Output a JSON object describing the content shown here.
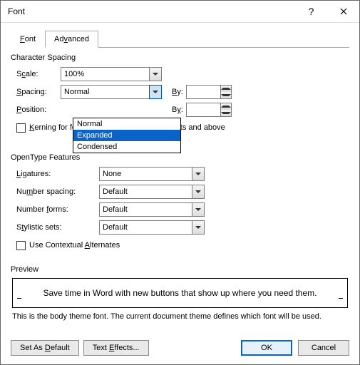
{
  "title": "Font",
  "tabs": {
    "font": "Font",
    "advanced": "Advanced"
  },
  "groups": {
    "charSpacing": "Character Spacing",
    "openType": "OpenType Features",
    "preview": "Preview"
  },
  "charSpacing": {
    "scaleLabel": "Scale:",
    "scaleValue": "100%",
    "spacingLabel": "Spacing:",
    "spacingValue": "Normal",
    "positionLabel": "Position:",
    "byLabel": "By:",
    "kerningLabel": "Kerning for fonts:",
    "kerningTail": "Points and above",
    "options": {
      "normal": "Normal",
      "expanded": "Expanded",
      "condensed": "Condensed"
    }
  },
  "openType": {
    "ligaturesLabel": "Ligatures:",
    "ligaturesValue": "None",
    "numSpacingLabel": "Number spacing:",
    "numSpacingValue": "Default",
    "numFormsLabel": "Number forms:",
    "numFormsValue": "Default",
    "styleSetsLabel": "Stylistic sets:",
    "styleSetsValue": "Default",
    "contextualLabel": "Use Contextual Alternates"
  },
  "preview": {
    "text": "Save time in Word with new buttons that show up where you need them.",
    "note": "This is the body theme font. The current document theme defines which font will be used."
  },
  "footer": {
    "setDefault": "Set As Default",
    "textEffects": "Text Effects...",
    "ok": "OK",
    "cancel": "Cancel"
  }
}
